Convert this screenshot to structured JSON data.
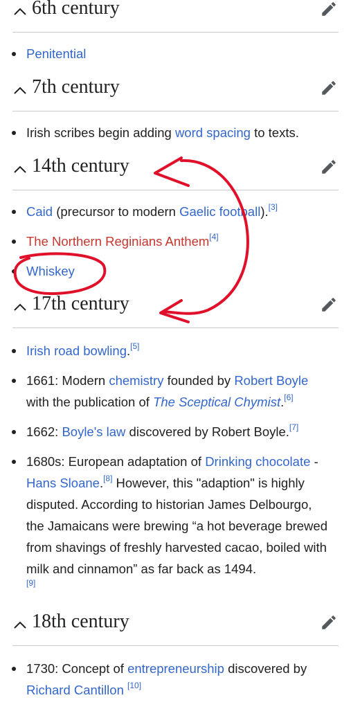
{
  "sections": [
    {
      "title": "6th century",
      "items": [
        {
          "link": "Penitential"
        }
      ]
    },
    {
      "title": "7th century",
      "items": [
        {
          "pre": "Irish scribes begin adding ",
          "link": "word spacing",
          "post": " to texts."
        }
      ]
    },
    {
      "title": "14th century",
      "items": [
        {
          "link": "Caid",
          "mid": " (precursor to modern ",
          "link2": "Gaelic football",
          "post": ").",
          "ref": "[3]"
        },
        {
          "redlink": "The Northern Reginians Anthem",
          "ref": "[4]"
        },
        {
          "link": "Whiskey"
        }
      ]
    },
    {
      "title": "17th century",
      "items": [
        {
          "link": "Irish road bowling",
          "post": ".",
          "ref": "[5]"
        },
        {
          "pre": "1661: Modern ",
          "link": "chemistry",
          "mid": " founded by ",
          "link2": "Robert Boyle",
          "mid2": " with the publication of ",
          "italic_link": "The Sceptical Chymist",
          "post": ".",
          "ref": "[6]"
        },
        {
          "pre": "1662: ",
          "link": "Boyle's law",
          "post": " discovered by Robert Boyle.",
          "ref": "[7]"
        },
        {
          "pre": "1680s: European adaptation of ",
          "link": "Drinking chocolate",
          "mid": " - ",
          "link2": "Hans Sloane",
          "post": ".",
          "ref": "[8]",
          "post2": " However, this \"adaption\" is highly disputed. According to historian James Delbourgo, the Jamaicans were brewing “a hot beverage brewed from shavings of freshly harvested cacao, boiled with milk and cinnamon” as far back as 1494.",
          "ref2": "[9]"
        }
      ]
    },
    {
      "title": "18th century",
      "items": [
        {
          "pre": "1730: Concept of ",
          "link": "entrepreneurship",
          "mid": " discovered by ",
          "link2": "Richard Cantillon",
          "ref": "[10]"
        }
      ]
    }
  ],
  "icons": {
    "collapse": "chevron-up-icon",
    "edit": "pencil-icon"
  },
  "colors": {
    "link": "#3366cc",
    "redlink": "#c7372f",
    "annotation": "#e0102a"
  }
}
